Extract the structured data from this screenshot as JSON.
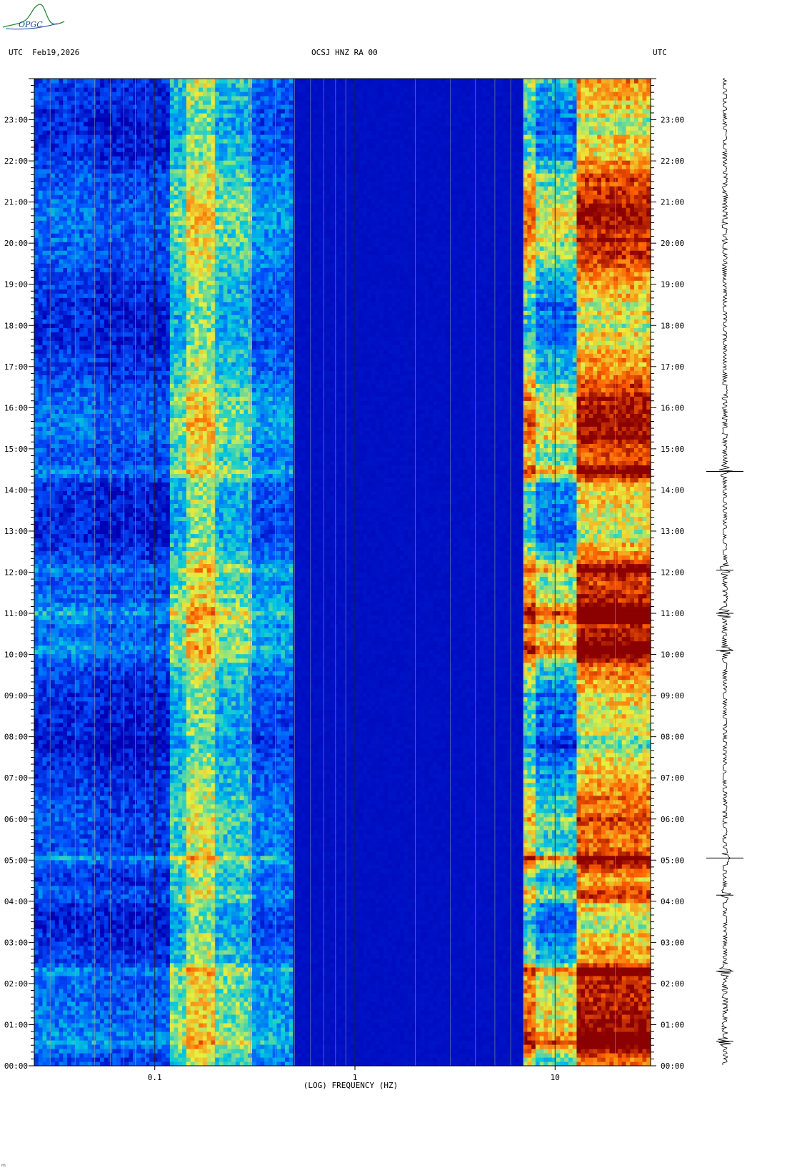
{
  "header": {
    "left_label": "UTC  Feb19,2026",
    "center_label": "OCSJ HNZ RA 00",
    "right_label": "UTC"
  },
  "logo": {
    "text": "OPGC"
  },
  "footer": {
    "mark": "m"
  },
  "colors": {
    "low": "#0000b4",
    "mid": "#00c8e0",
    "high_yellow": "#e8f040",
    "max": "#8b0000"
  },
  "chart_data": {
    "type": "heatmap",
    "title": "OCSJ HNZ RA 00",
    "xlabel": "(LOG) FREQUENCY (HZ)",
    "ylabel": "UTC",
    "x_scale": "log",
    "xlim": [
      0.025,
      30
    ],
    "ylim": [
      0,
      24
    ],
    "x_ticks": [
      {
        "value": 0.1,
        "label": "0.1"
      },
      {
        "value": 1,
        "label": "1"
      },
      {
        "value": 10,
        "label": "10"
      }
    ],
    "y_ticks": [
      {
        "value": 0,
        "label": "00:00"
      },
      {
        "value": 1,
        "label": "01:00"
      },
      {
        "value": 2,
        "label": "02:00"
      },
      {
        "value": 3,
        "label": "03:00"
      },
      {
        "value": 4,
        "label": "04:00"
      },
      {
        "value": 5,
        "label": "05:00"
      },
      {
        "value": 6,
        "label": "06:00"
      },
      {
        "value": 7,
        "label": "07:00"
      },
      {
        "value": 8,
        "label": "08:00"
      },
      {
        "value": 9,
        "label": "09:00"
      },
      {
        "value": 10,
        "label": "10:00"
      },
      {
        "value": 11,
        "label": "11:00"
      },
      {
        "value": 12,
        "label": "12:00"
      },
      {
        "value": 13,
        "label": "13:00"
      },
      {
        "value": 14,
        "label": "14:00"
      },
      {
        "value": 15,
        "label": "15:00"
      },
      {
        "value": 16,
        "label": "16:00"
      },
      {
        "value": 17,
        "label": "17:00"
      },
      {
        "value": 18,
        "label": "18:00"
      },
      {
        "value": 19,
        "label": "19:00"
      },
      {
        "value": 20,
        "label": "20:00"
      },
      {
        "value": 21,
        "label": "21:00"
      },
      {
        "value": 22,
        "label": "22:00"
      },
      {
        "value": 23,
        "label": "23:00"
      }
    ],
    "colormap": [
      "#0000b4",
      "#0050ff",
      "#00c8e0",
      "#e8f040",
      "#ff6000",
      "#8b0000"
    ],
    "frequency_bands": [
      {
        "f": [
          0.025,
          0.05
        ],
        "level": 0.18
      },
      {
        "f": [
          0.05,
          0.12
        ],
        "level": 0.14
      },
      {
        "f": [
          0.12,
          0.145
        ],
        "level": 0.42
      },
      {
        "f": [
          0.145,
          0.2
        ],
        "level": 0.58
      },
      {
        "f": [
          0.2,
          0.3
        ],
        "level": 0.42
      },
      {
        "f": [
          0.3,
          0.5
        ],
        "level": 0.25
      },
      {
        "f": [
          0.5,
          7.0
        ],
        "level": 0.03
      },
      {
        "f": [
          7.0,
          8.0
        ],
        "level": 0.6
      },
      {
        "f": [
          8.0,
          13.0
        ],
        "level": 0.42
      },
      {
        "f": [
          13.0,
          30.0
        ],
        "level": 0.78
      }
    ],
    "noted_events_utc": [
      0.6,
      2.3,
      4.15,
      5.05,
      10.1,
      11.0,
      12.05,
      14.45
    ]
  }
}
